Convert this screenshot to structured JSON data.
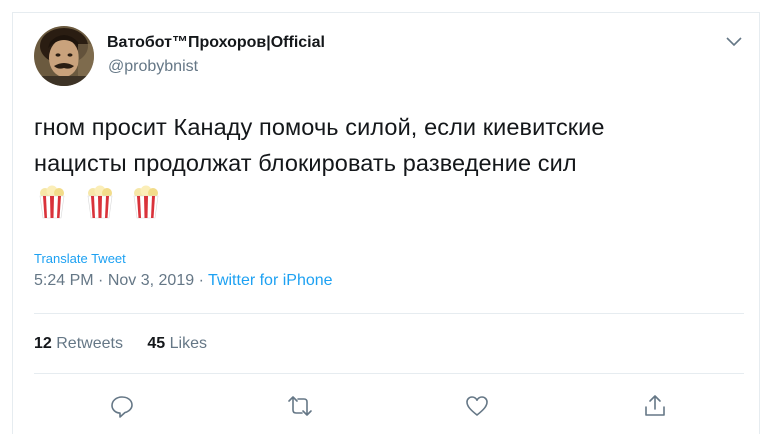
{
  "tweet": {
    "author_name": "Ватобот™Прохоров|Official",
    "author_handle": "@probybnist",
    "text_line1": "гном просит Канаду помочь силой, если киевитские",
    "text_line2": "нацисты продолжат блокировать разведение сил",
    "emojis": [
      "popcorn-emoji",
      "popcorn-emoji",
      "popcorn-emoji"
    ],
    "translate_label": "Translate Tweet",
    "time": "5:24 PM",
    "separator": "·",
    "date": "Nov 3, 2019",
    "source": "Twitter for iPhone",
    "retweets_count": "12",
    "retweets_label": "Retweets",
    "likes_count": "45",
    "likes_label": "Likes"
  },
  "actions": [
    "reply-icon",
    "retweet-icon",
    "like-icon",
    "share-icon"
  ],
  "colors": {
    "text": "#14171a",
    "secondary": "#657786",
    "link": "#1da1f2",
    "divider": "#e6ecf0"
  }
}
